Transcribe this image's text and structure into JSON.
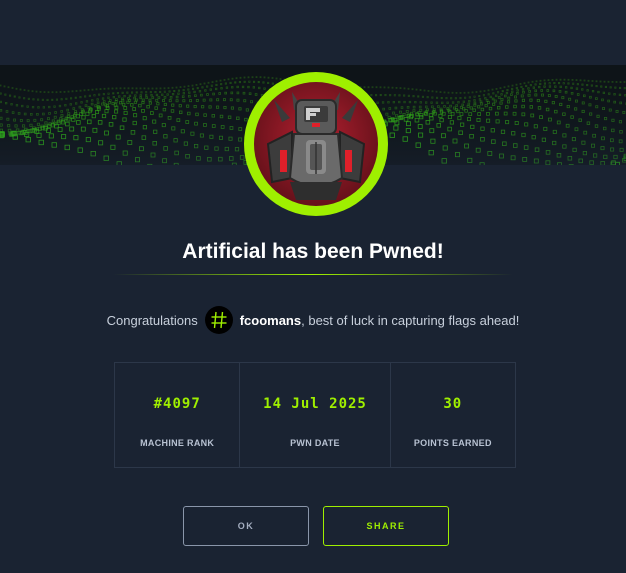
{
  "title": "Artificial has been Pwned!",
  "congrats": {
    "prefix": "Congratulations",
    "username": "fcoomans",
    "suffix": ", best of luck in capturing flags ahead!"
  },
  "stats": [
    {
      "value": "#4097",
      "label": "MACHINE RANK"
    },
    {
      "value": "14 Jul 2025",
      "label": "PWN DATE"
    },
    {
      "value": "30",
      "label": "POINTS EARNED"
    }
  ],
  "buttons": {
    "ok": "OK",
    "share": "SHARE"
  },
  "colors": {
    "accent": "#9fef00",
    "background": "#1a2332"
  },
  "icons": {
    "user_avatar": "hashtag-icon",
    "machine_avatar": "robot-icon"
  }
}
